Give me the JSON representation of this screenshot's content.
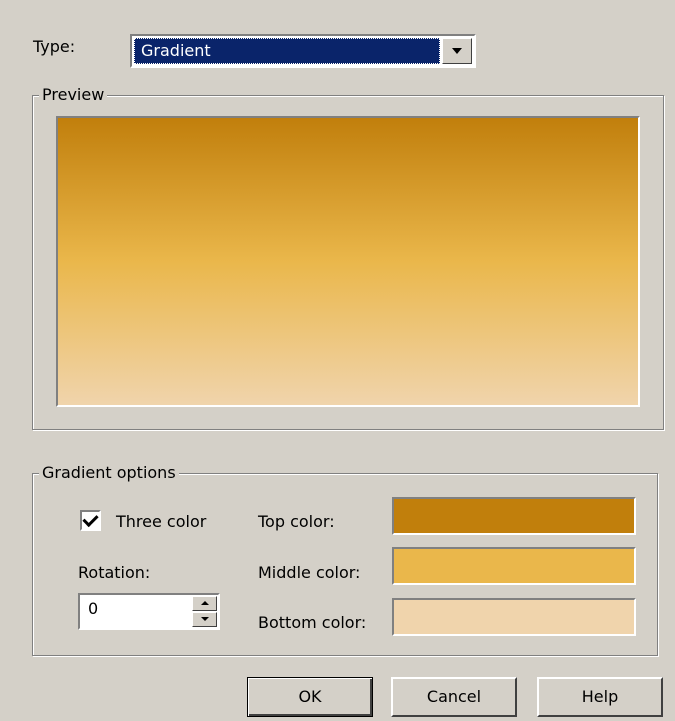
{
  "type_row": {
    "label": "Type:",
    "selected": "Gradient"
  },
  "preview": {
    "title": "Preview"
  },
  "gradient_options": {
    "title": "Gradient options",
    "three_color_label": "Three color",
    "three_color_checked": true,
    "rotation_label": "Rotation:",
    "rotation_value": "0",
    "top_color_label": "Top color:",
    "middle_color_label": "Middle color:",
    "bottom_color_label": "Bottom color:"
  },
  "colors": {
    "top": "#c17f0c",
    "middle": "#eab74b",
    "bottom": "#f0d4ac",
    "dialog_bg": "#d4d0c8",
    "selection_bg": "#0a246a"
  },
  "buttons": {
    "ok": "OK",
    "cancel": "Cancel",
    "help": "Help"
  }
}
